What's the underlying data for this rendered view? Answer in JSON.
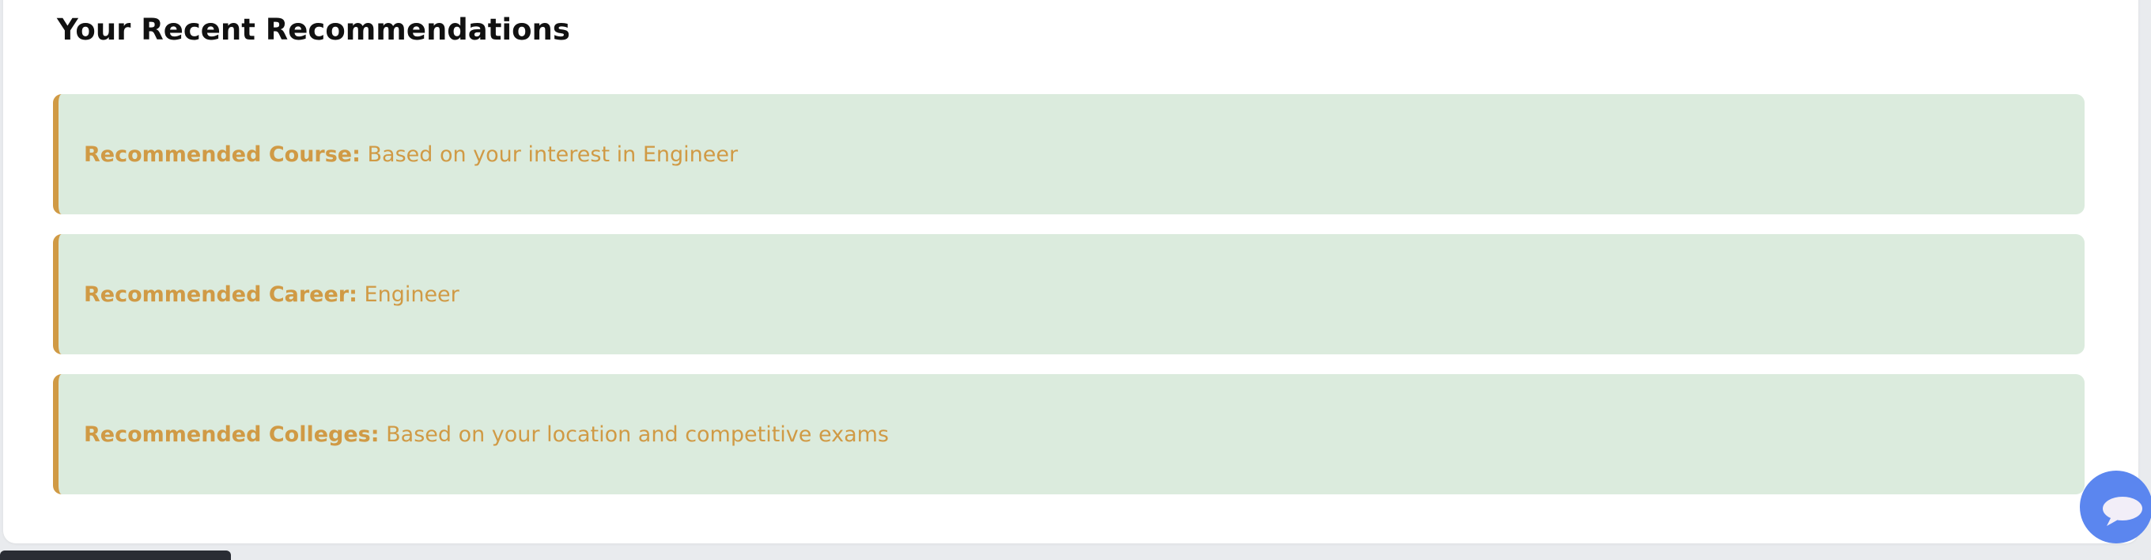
{
  "section": {
    "title": "Your Recent Recommendations"
  },
  "recommendations": [
    {
      "label": "Recommended Course:",
      "value": "Based on your interest in Engineer"
    },
    {
      "label": "Recommended Career:",
      "value": "Engineer"
    },
    {
      "label": "Recommended Colleges:",
      "value": "Based on your location and competitive exams"
    }
  ],
  "chat_widget": {
    "icon": "chat-bubble-icon"
  },
  "colors": {
    "accent": "#d09a45",
    "item_background": "#dbebdd",
    "chat_button": "#5b86ef",
    "page_background": "#e9ebee"
  }
}
